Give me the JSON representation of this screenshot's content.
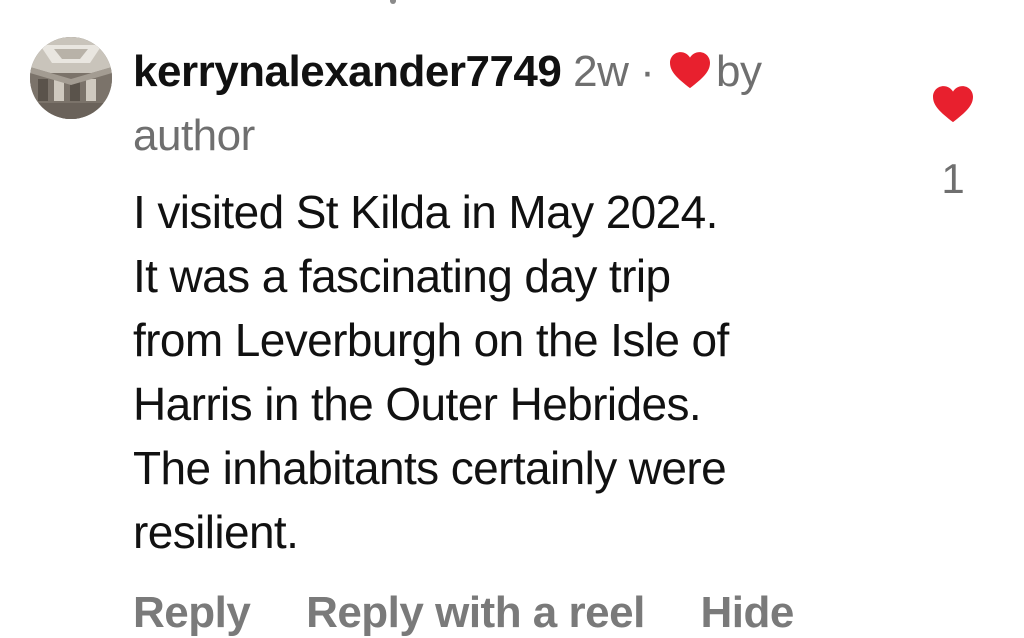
{
  "comment": {
    "username": "kerrynalexander7749",
    "age": "2w",
    "separator": "·",
    "liked_by_label": "by",
    "author_label": "author",
    "body_lines": [
      "I visited St Kilda in May 2024.",
      "It was a fascinating day trip",
      "from Leverburgh on the Isle of",
      "Harris in the Outer Hebrides.",
      "The inhabitants certainly were",
      "resilient."
    ],
    "like_count": "1"
  },
  "actions": {
    "reply": "Reply",
    "reply_with_reel": "Reply with a reel",
    "hide": "Hide"
  },
  "colors": {
    "heart": "#e8202e",
    "meta_text": "#6f6f6f",
    "action_text": "#7a7a7a"
  },
  "icons": {
    "liked_by_author": "heart-icon",
    "like": "heart-icon"
  }
}
